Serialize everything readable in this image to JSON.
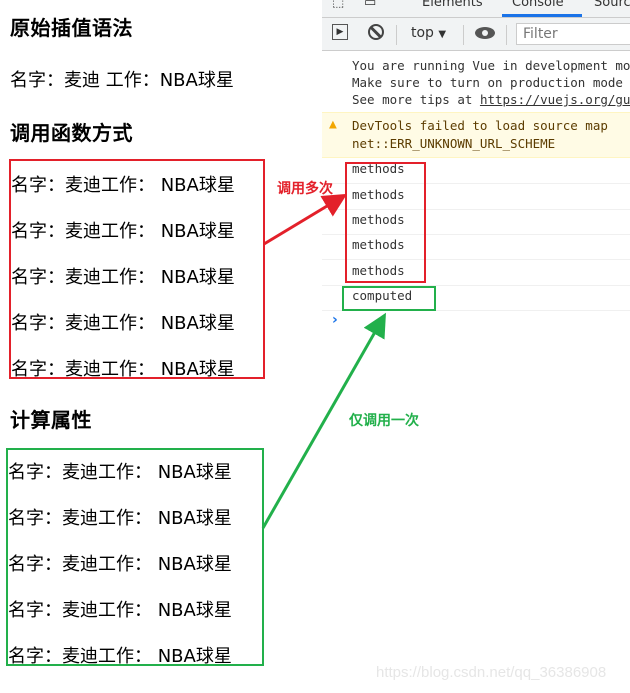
{
  "sections": [
    {
      "heading": "原始插值语法",
      "lines": [
        "名字：麦迪 工作：NBA球星"
      ]
    },
    {
      "heading": "调用函数方式",
      "lines": [
        "名字：麦迪工作：  NBA球星",
        "名字：麦迪工作：  NBA球星",
        "名字：麦迪工作：  NBA球星",
        "名字：麦迪工作：  NBA球星",
        "名字：麦迪工作：  NBA球星"
      ]
    },
    {
      "heading": "计算属性",
      "lines": [
        "名字：麦迪工作：  NBA球星",
        "名字：麦迪工作：  NBA球星",
        "名字：麦迪工作：  NBA球星",
        "名字：麦迪工作：  NBA球星",
        "名字：麦迪工作：  NBA球星"
      ]
    }
  ],
  "devtools": {
    "tabs": [
      "Elements",
      "Console",
      "Sources"
    ],
    "active_tab": "Console",
    "context": "top",
    "filter_placeholder": "Filter",
    "info_lines": [
      "You are running Vue in development mode.",
      "Make sure to turn on production mode when deploying for production.",
      "See more tips at https://vuejs.org/guide/deployment.html"
    ],
    "warning_lines": [
      "DevTools failed to load source map",
      "net::ERR_UNKNOWN_URL_SCHEME"
    ],
    "logs": [
      "methods",
      "methods",
      "methods",
      "methods",
      "methods",
      "computed"
    ],
    "prompt": "›"
  },
  "annotations": {
    "methods_label": "调用多次",
    "computed_label": "仅调用一次",
    "methods_color": "#e3202a",
    "computed_color": "#22b04b"
  },
  "watermark": "https://blog.csdn.net/qq_36386908"
}
